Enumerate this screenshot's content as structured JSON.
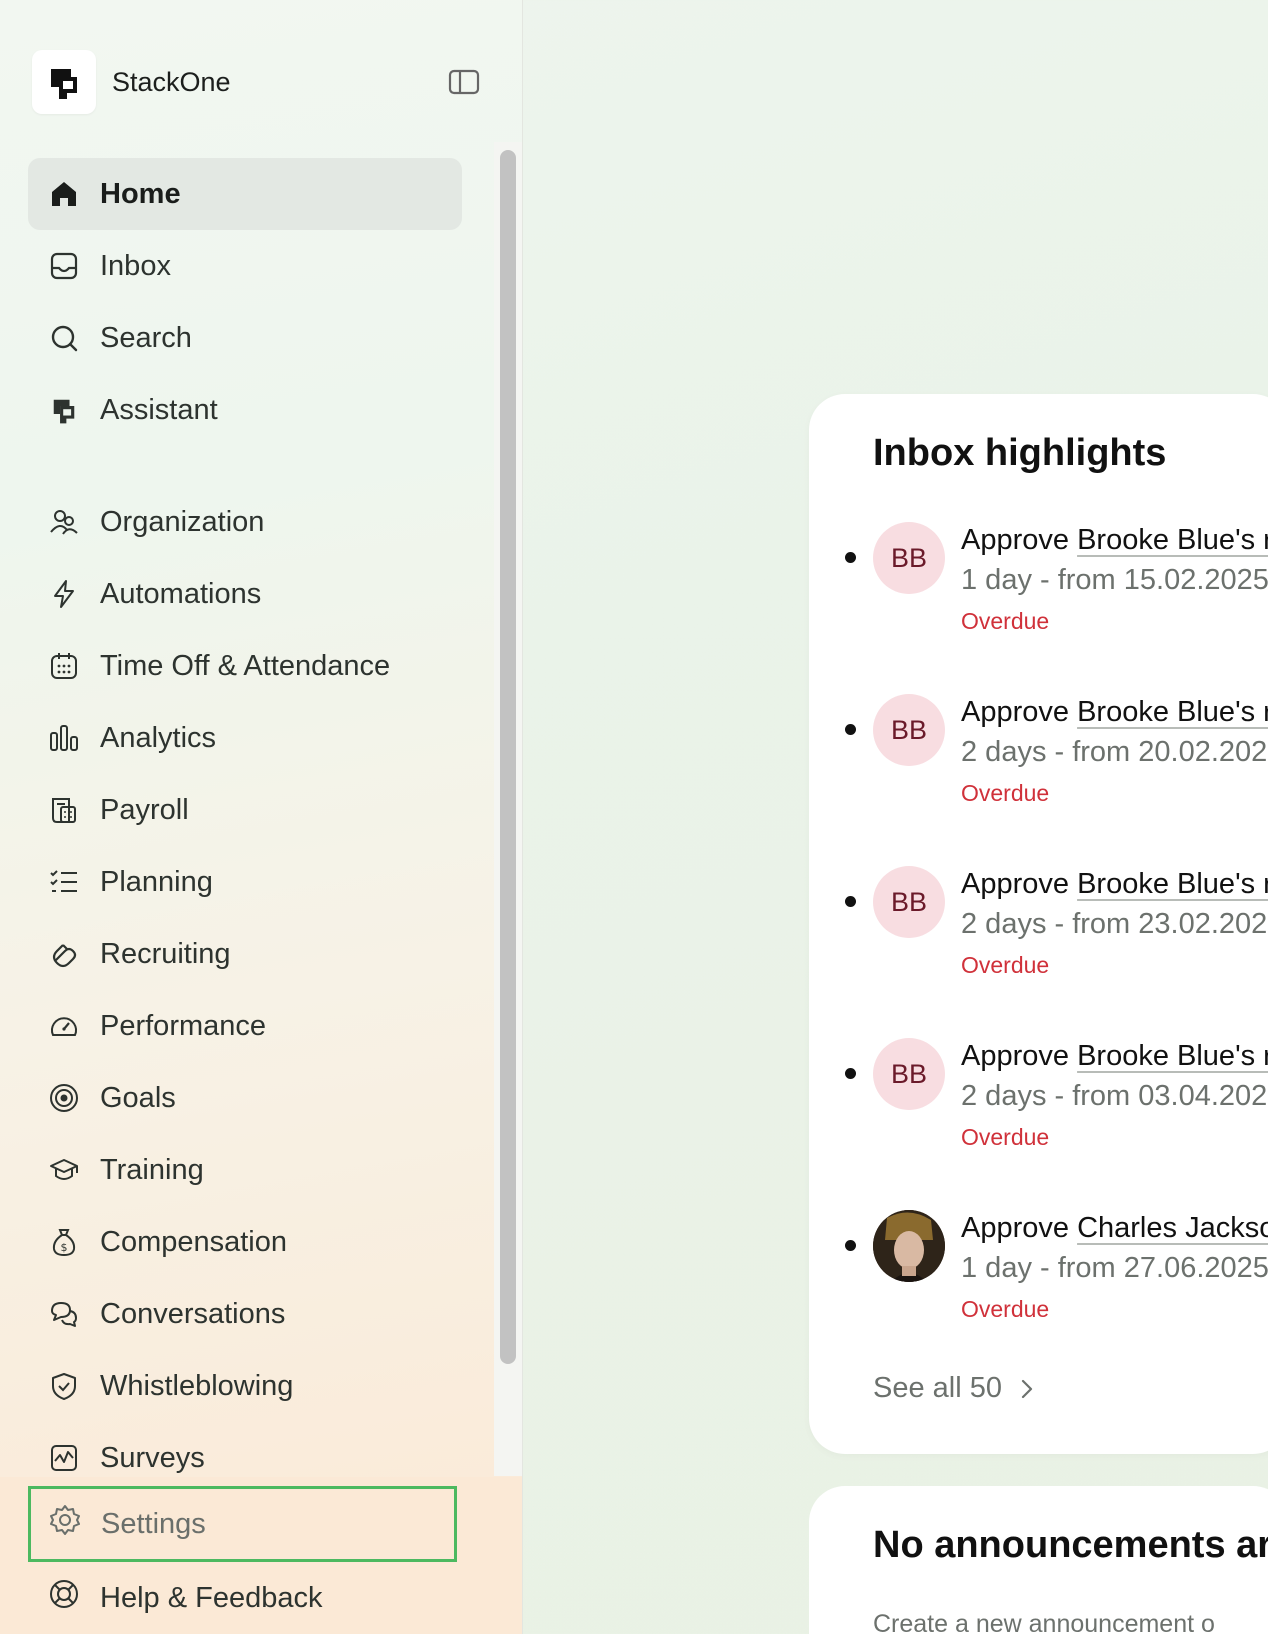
{
  "app": {
    "name": "StackOne"
  },
  "sidebar": {
    "primary": [
      {
        "label": "Home",
        "icon": "home-icon",
        "active": true
      },
      {
        "label": "Inbox",
        "icon": "inbox-icon"
      },
      {
        "label": "Search",
        "icon": "search-icon"
      },
      {
        "label": "Assistant",
        "icon": "assistant-icon"
      }
    ],
    "modules": [
      {
        "label": "Organization",
        "icon": "people-icon"
      },
      {
        "label": "Automations",
        "icon": "lightning-icon"
      },
      {
        "label": "Time Off & Attendance",
        "icon": "calendar-icon"
      },
      {
        "label": "Analytics",
        "icon": "bar-chart-icon"
      },
      {
        "label": "Payroll",
        "icon": "calculator-icon"
      },
      {
        "label": "Planning",
        "icon": "checklist-icon"
      },
      {
        "label": "Recruiting",
        "icon": "magnet-icon"
      },
      {
        "label": "Performance",
        "icon": "gauge-icon"
      },
      {
        "label": "Goals",
        "icon": "target-icon"
      },
      {
        "label": "Training",
        "icon": "graduation-cap-icon"
      },
      {
        "label": "Compensation",
        "icon": "money-bag-icon"
      },
      {
        "label": "Conversations",
        "icon": "chat-bubbles-icon"
      },
      {
        "label": "Whistleblowing",
        "icon": "shield-check-icon"
      },
      {
        "label": "Surveys",
        "icon": "pulse-icon"
      }
    ],
    "settings": {
      "label": "Settings",
      "icon": "gear-icon"
    },
    "help": {
      "label": "Help & Feedback",
      "icon": "lifebuoy-icon"
    }
  },
  "inbox_highlights": {
    "title": "Inbox highlights",
    "items": [
      {
        "initials": "BB",
        "action": "Approve",
        "who": "Brooke Blue's r",
        "detail": "1 day - from 15.02.2025",
        "status": "Overdue"
      },
      {
        "initials": "BB",
        "action": "Approve",
        "who": "Brooke Blue's r",
        "detail": "2 days - from 20.02.202",
        "status": "Overdue"
      },
      {
        "initials": "BB",
        "action": "Approve",
        "who": "Brooke Blue's r",
        "detail": "2 days - from 23.02.202",
        "status": "Overdue"
      },
      {
        "initials": "BB",
        "action": "Approve",
        "who": "Brooke Blue's r",
        "detail": "2 days - from 03.04.202",
        "status": "Overdue"
      },
      {
        "initials": "",
        "photo": true,
        "action": "Approve",
        "who": "Charles Jackso",
        "detail": "1 day - from 27.06.2025",
        "status": "Overdue"
      }
    ],
    "see_all": "See all 50"
  },
  "announcements": {
    "title": "No announcements ar",
    "subtitle": "Create a new announcement o"
  },
  "colors": {
    "active_bg": "#e3e8e3",
    "overdue": "#d0313a",
    "avatar_bg": "#f8dde1",
    "highlight_border": "#4cb960"
  }
}
